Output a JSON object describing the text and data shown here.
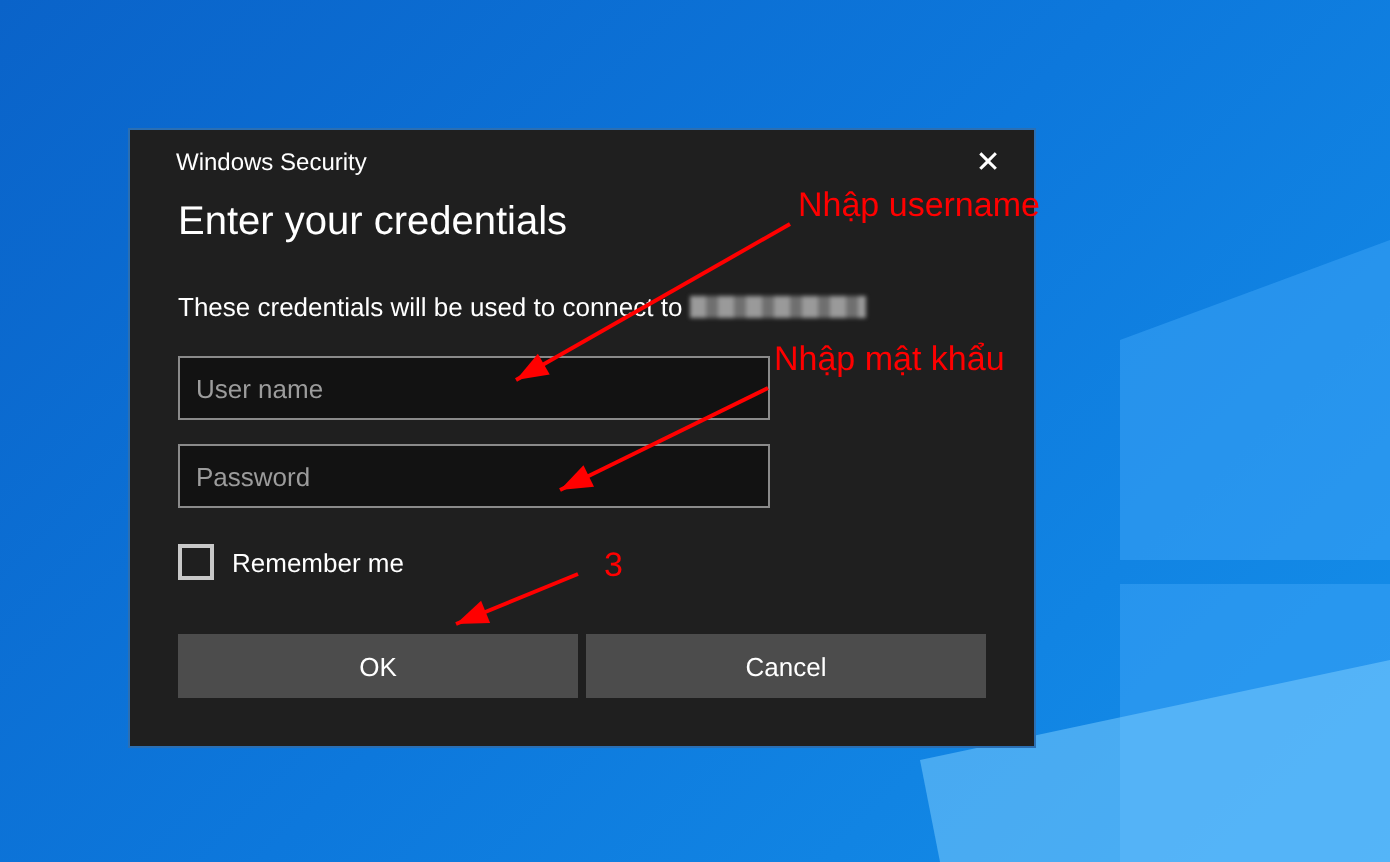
{
  "window": {
    "title": "Windows Security",
    "close_glyph": "✕"
  },
  "heading": "Enter your credentials",
  "message": "These credentials will be used to connect to",
  "fields": [
    {
      "placeholder": "User name"
    },
    {
      "placeholder": "Password"
    }
  ],
  "remember": {
    "label": "Remember me",
    "checked": false
  },
  "buttons": [
    "OK",
    "Cancel"
  ],
  "annotations": [
    {
      "text": "Nhập username"
    },
    {
      "text": "Nhập mật khẩu"
    },
    {
      "text": "3"
    }
  ]
}
